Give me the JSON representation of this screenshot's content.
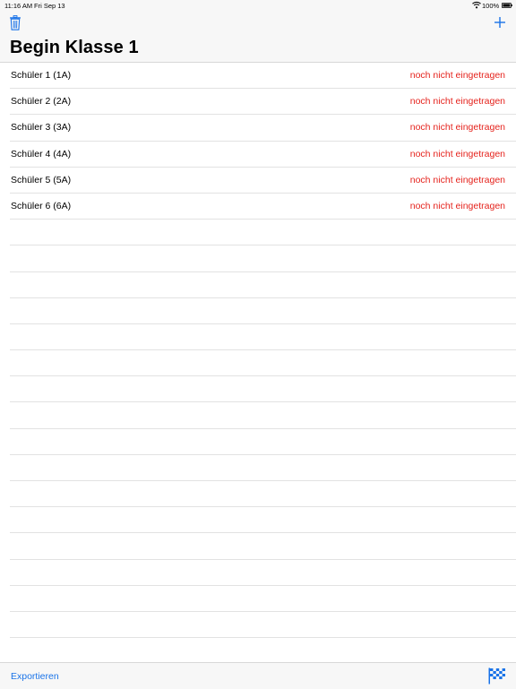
{
  "status_bar": {
    "time": "11:16 AM",
    "date": "Fri Sep 13",
    "battery": "100%",
    "icons": [
      "wifi-icon",
      "battery-icon"
    ]
  },
  "nav": {
    "title": "Begin Klasse 1",
    "left_icon": "trash-icon",
    "right_icon": "plus-icon"
  },
  "students": [
    {
      "name": "Schüler 1 (1A)",
      "status": "noch nicht eingetragen"
    },
    {
      "name": "Schüler 2 (2A)",
      "status": "noch nicht eingetragen"
    },
    {
      "name": "Schüler 3 (3A)",
      "status": "noch nicht eingetragen"
    },
    {
      "name": "Schüler 4 (4A)",
      "status": "noch nicht eingetragen"
    },
    {
      "name": "Schüler 5 (5A)",
      "status": "noch nicht eingetragen"
    },
    {
      "name": "Schüler 6 (6A)",
      "status": "noch nicht eingetragen"
    }
  ],
  "toolbar": {
    "export_label": "Exportieren",
    "right_icon": "checkered-flag-icon"
  },
  "colors": {
    "accent": "#1a73e8",
    "status_red": "#e5231d",
    "bar_background": "#f7f7f7"
  }
}
